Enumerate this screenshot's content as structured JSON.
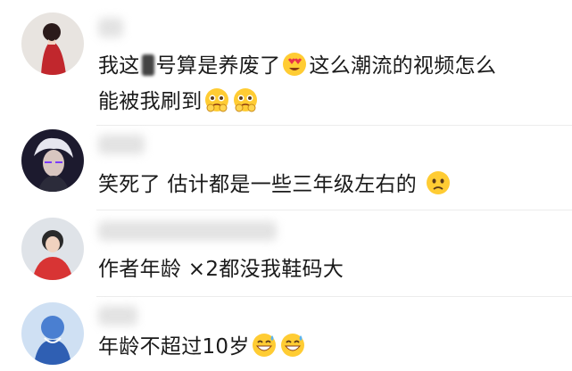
{
  "comments": [
    {
      "line1_a": "我这",
      "line1_b": "号算是养废了",
      "line1_c": "这么潮流的视频怎么",
      "line2": "能被我刷到",
      "emoji_1": "heart-eyes-emoji",
      "emoji_2": "pleading-face-emoji"
    },
    {
      "text": "笑死了 估计都是一些三年级左右的",
      "emoji": "frowning-face-emoji"
    },
    {
      "text": "作者年龄 ×2都没我鞋码大"
    },
    {
      "text": "年龄不超过10岁",
      "emoji": "grinning-sweat-emoji"
    }
  ]
}
